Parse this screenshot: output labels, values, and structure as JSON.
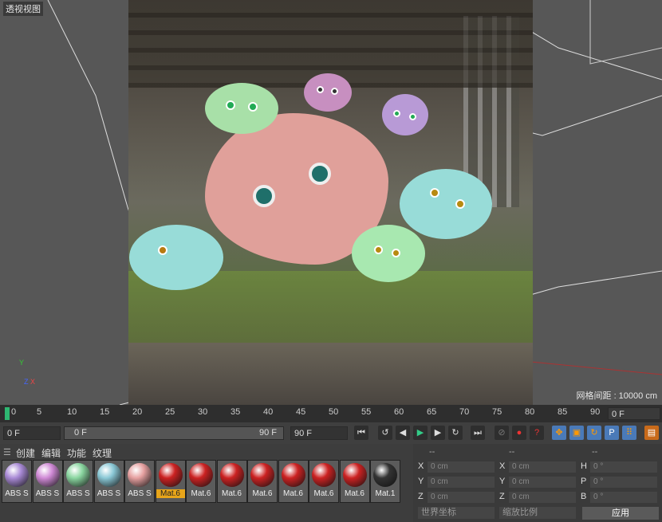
{
  "viewport": {
    "title": "透视视图",
    "grid_spacing": "网格间距 : 10000 cm",
    "axis_labels": {
      "y": "Y",
      "z": "Z",
      "x": "X"
    }
  },
  "timeline": {
    "ticks": [
      "0",
      "5",
      "10",
      "15",
      "20",
      "25",
      "30",
      "35",
      "40",
      "45",
      "50",
      "55",
      "60",
      "65",
      "70",
      "75",
      "80",
      "85",
      "90"
    ],
    "current_frame": "0 F"
  },
  "controls": {
    "start_frame": "0 F",
    "range_start": "0 F",
    "range_end": "90 F",
    "end_frame": "90 F",
    "play_icons": [
      "go-to-start-icon",
      "prev-key-icon",
      "step-back-icon",
      "play-icon",
      "step-forward-icon",
      "next-key-icon",
      "go-to-end-icon"
    ]
  },
  "materials": {
    "menu": [
      "创建",
      "编辑",
      "功能",
      "纹理"
    ],
    "items": [
      {
        "label": "ABS S",
        "color": "#a98ad6"
      },
      {
        "label": "ABS S",
        "color": "#d08ad6"
      },
      {
        "label": "ABS S",
        "color": "#8ad6a0"
      },
      {
        "label": "ABS S",
        "color": "#8ac8d6"
      },
      {
        "label": "ABS S",
        "color": "#e6a0a0"
      },
      {
        "label": "Mat.6",
        "color": "#cc2222",
        "selected": true
      },
      {
        "label": "Mat.6",
        "color": "#cc2222"
      },
      {
        "label": "Mat.6",
        "color": "#cc2222"
      },
      {
        "label": "Mat.6",
        "color": "#cc2222"
      },
      {
        "label": "Mat.6",
        "color": "#cc2222"
      },
      {
        "label": "Mat.6",
        "color": "#cc2222"
      },
      {
        "label": "Mat.6",
        "color": "#cc2222"
      },
      {
        "label": "Mat.1",
        "color": "#333333"
      }
    ]
  },
  "coords": {
    "headers": [
      "--",
      "--",
      "--"
    ],
    "rows": [
      {
        "a": "X",
        "av": "0 cm",
        "b": "X",
        "bv": "0 cm",
        "c": "H",
        "cv": "0 °"
      },
      {
        "a": "Y",
        "av": "0 cm",
        "b": "Y",
        "bv": "0 cm",
        "c": "P",
        "cv": "0 °"
      },
      {
        "a": "Z",
        "av": "0 cm",
        "b": "Z",
        "bv": "0 cm",
        "c": "B",
        "cv": "0 °"
      }
    ],
    "mode": "世界坐标",
    "scale": "缩放比例",
    "apply": "应用"
  }
}
